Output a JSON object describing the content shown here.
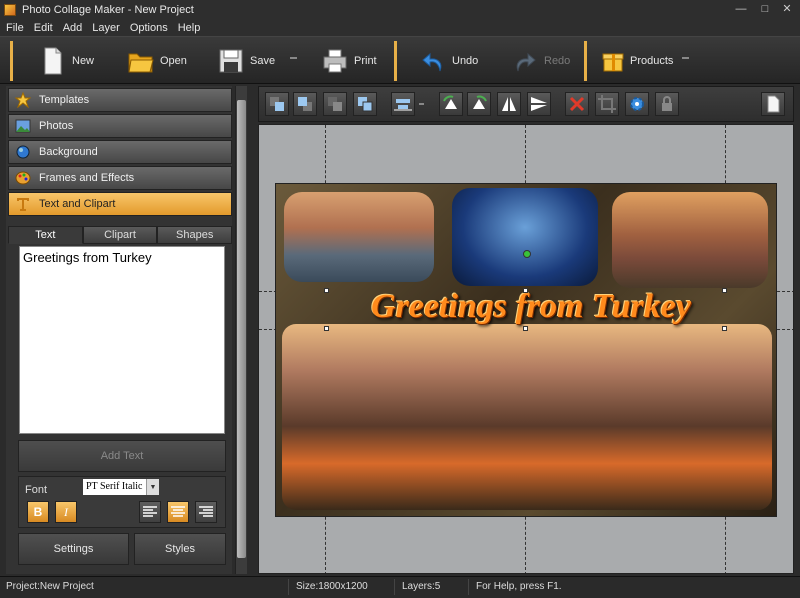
{
  "window": {
    "title": "Photo Collage Maker - New Project"
  },
  "menu": [
    "File",
    "Edit",
    "Add",
    "Layer",
    "Options",
    "Help"
  ],
  "toolbar": {
    "new": "New",
    "open": "Open",
    "save": "Save",
    "print": "Print",
    "undo": "Undo",
    "redo": "Redo",
    "products": "Products"
  },
  "sidebar": {
    "sections": [
      "Templates",
      "Photos",
      "Background",
      "Frames and Effects",
      "Text and Clipart"
    ],
    "active_section": "Text and Clipart",
    "tabs": [
      "Text",
      "Clipart",
      "Shapes"
    ],
    "active_tab": "Text",
    "text_value": "Greetings from Turkey",
    "add_text": "Add Text",
    "font_label": "Font",
    "font_value": "PT Serif Italic",
    "bold_glyph": "B",
    "italic_glyph": "I",
    "settings": "Settings",
    "styles": "Styles"
  },
  "collage": {
    "headline": "Greetings from Turkey"
  },
  "status": {
    "project": "Project:New Project",
    "size": "Size:1800x1200",
    "layers": "Layers:5",
    "help": "For Help, press F1."
  },
  "colors": {
    "accent": "#e8b048",
    "headline": "#ff8a1c"
  }
}
